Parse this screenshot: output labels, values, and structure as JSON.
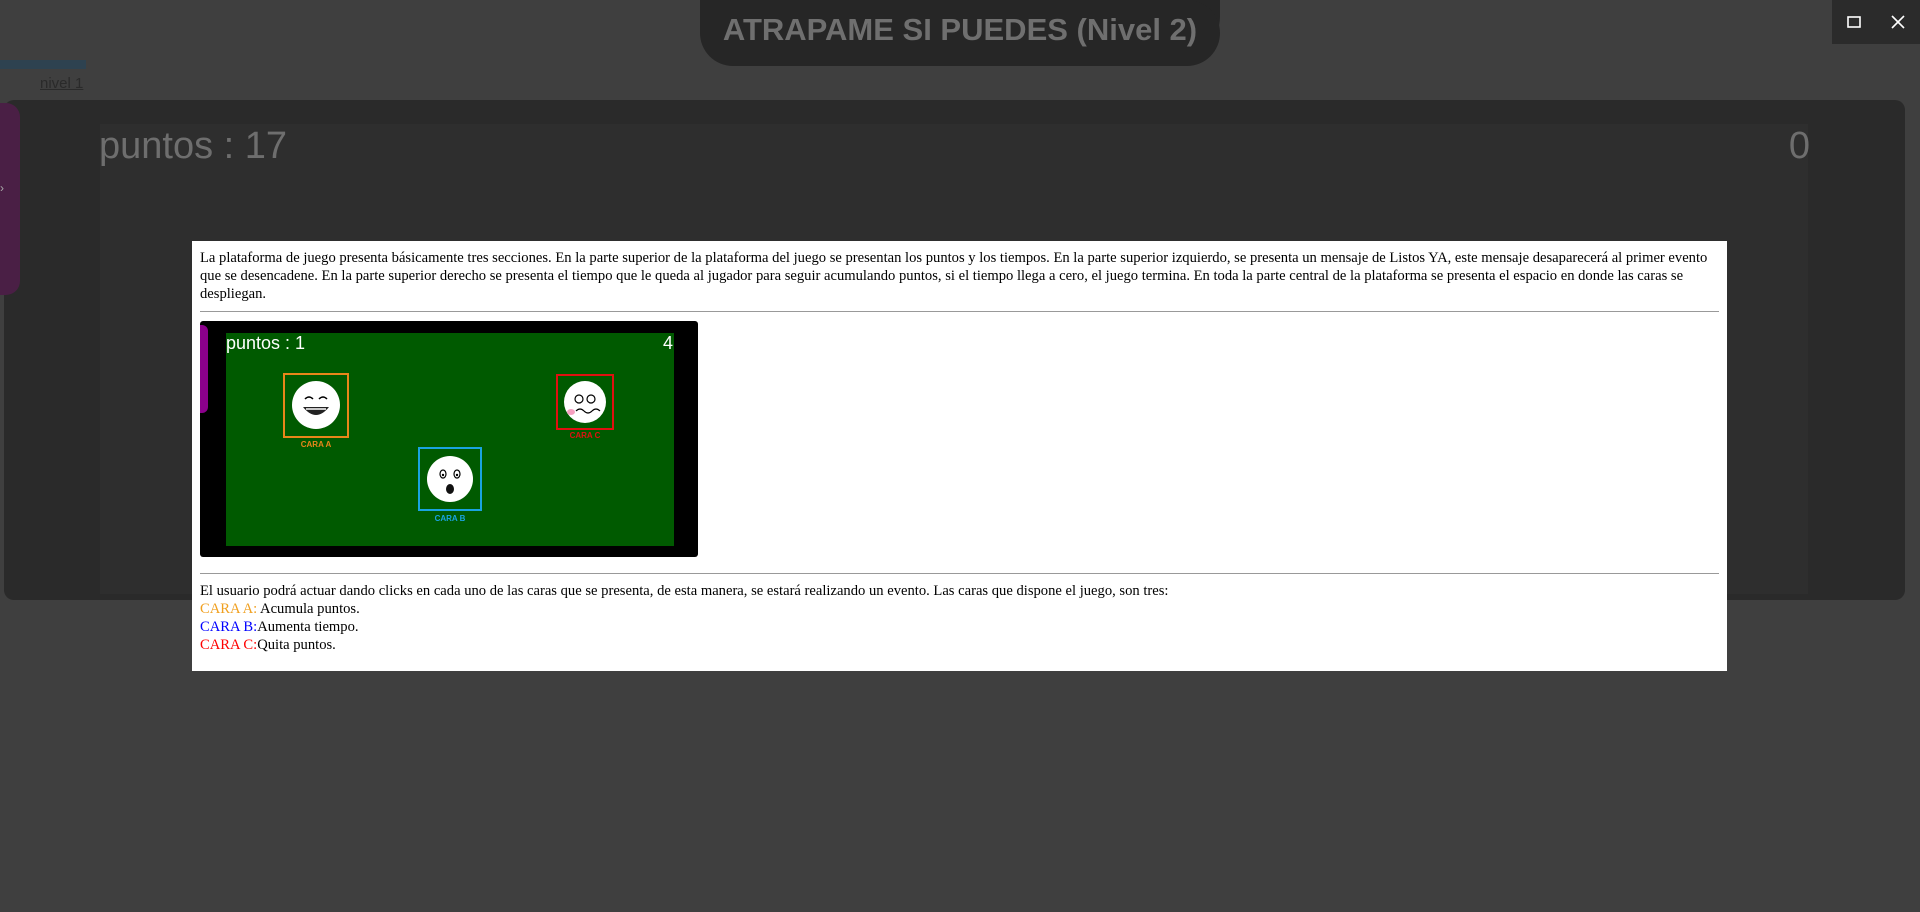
{
  "header": {
    "title": "ATRAPAME SI PUEDES (Nivel 2)"
  },
  "nav": {
    "level_link": "nivel 1"
  },
  "background_game": {
    "score_text": "puntos : 17",
    "time_text": "0"
  },
  "window_controls": {
    "maximize_icon": "maximize-icon",
    "close_icon": "close-icon"
  },
  "modal": {
    "intro": "La plataforma de juego presenta básicamente tres secciones. En la parte superior de la plataforma del juego se presentan los puntos y los tiempos. En la parte superior izquierdo, se presenta un mensaje de Listos YA, este mensaje desaparecerá al primer evento que se desencadene. En la parte superior derecho se presenta el tiempo que le queda al jugador para seguir acumulando puntos, si el tiempo llega a cero, el juego termina. En toda la parte central de la plataforma se presenta el espacio en donde las caras se despliegan.",
    "preview": {
      "score_text": "puntos : 1",
      "time_text": "4",
      "faces": [
        {
          "label": "CARA A",
          "color": "#e8861a"
        },
        {
          "label": "CARA B",
          "color": "#1aa3e0"
        },
        {
          "label": "CARA C",
          "color": "#e01010"
        }
      ]
    },
    "usage": "El usuario podrá actuar dando clicks en cada uno de las caras que se presenta, de esta manera, se estará realizando un evento. Las caras que dispone el juego, son tres:",
    "legend": [
      {
        "name": "CARA A:",
        "desc": " Acumula puntos.",
        "color": "#f0a020"
      },
      {
        "name": "CARA B:",
        "desc": "Aumenta tiempo.",
        "color": "#0000ff"
      },
      {
        "name": "CARA C:",
        "desc": "Quita puntos.",
        "color": "#ff0000"
      }
    ]
  }
}
